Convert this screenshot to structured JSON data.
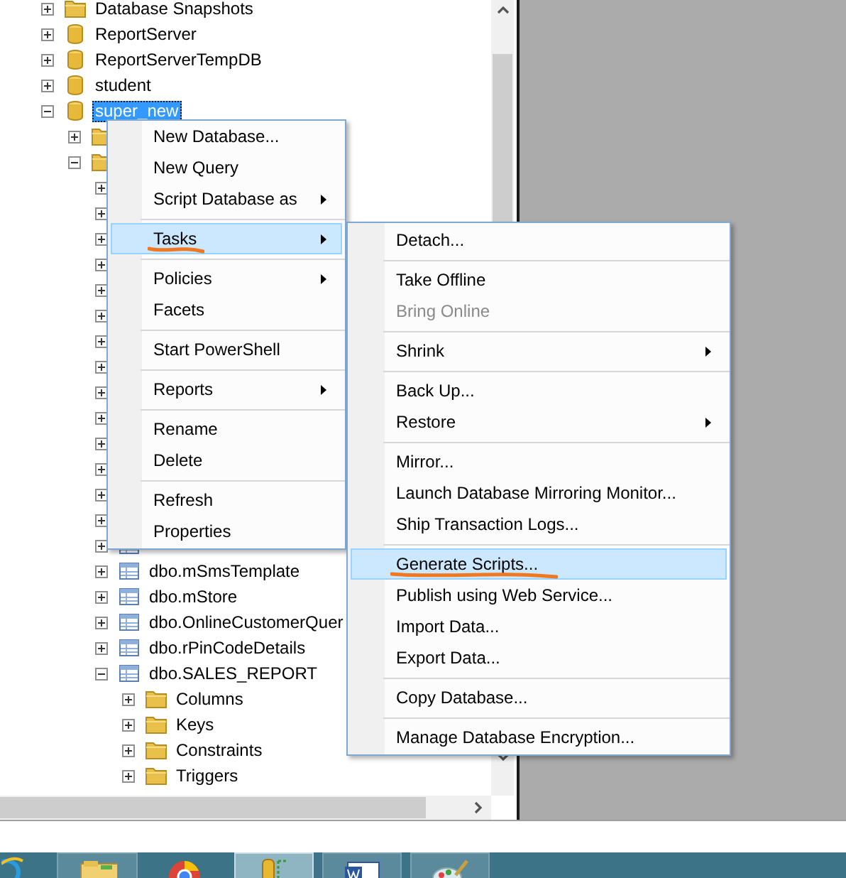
{
  "tree": [
    {
      "label": "Database Snapshots",
      "kind": "folder",
      "expanded": false
    },
    {
      "label": "ReportServer",
      "kind": "database",
      "expanded": false
    },
    {
      "label": "ReportServerTempDB",
      "kind": "database",
      "expanded": false
    },
    {
      "label": "student",
      "kind": "database",
      "expanded": false
    },
    {
      "label": "super_new",
      "kind": "database",
      "expanded": true,
      "selected": true,
      "children": [
        {
          "kind": "folder",
          "expanded": false
        },
        {
          "kind": "folder",
          "expanded": true,
          "children": [
            {
              "expanded": false
            },
            {
              "expanded": false
            },
            {
              "expanded": false
            },
            {
              "expanded": false
            },
            {
              "expanded": false
            },
            {
              "expanded": false
            },
            {
              "expanded": false
            },
            {
              "expanded": false
            },
            {
              "expanded": false
            },
            {
              "expanded": false
            },
            {
              "expanded": false
            },
            {
              "expanded": false
            },
            {
              "expanded": false
            },
            {
              "expanded": false
            },
            {
              "kind": "table",
              "expanded": false
            },
            {
              "label": "dbo.mSmsTemplate",
              "kind": "table",
              "expanded": false
            },
            {
              "label": "dbo.mStore",
              "kind": "table",
              "expanded": false
            },
            {
              "label": "dbo.OnlineCustomerQuer",
              "kind": "table",
              "expanded": false
            },
            {
              "label": "dbo.rPinCodeDetails",
              "kind": "table",
              "expanded": false
            },
            {
              "label": "dbo.SALES_REPORT",
              "kind": "table",
              "expanded": true,
              "children": [
                {
                  "label": "Columns",
                  "kind": "folder",
                  "expanded": false
                },
                {
                  "label": "Keys",
                  "kind": "folder",
                  "expanded": false
                },
                {
                  "label": "Constraints",
                  "kind": "folder",
                  "expanded": false
                },
                {
                  "label": "Triggers",
                  "kind": "folder",
                  "expanded": false
                }
              ]
            }
          ]
        }
      ]
    }
  ],
  "context_menu": [
    {
      "kind": "item",
      "label": "New Database..."
    },
    {
      "kind": "item",
      "label": "New Query"
    },
    {
      "kind": "item",
      "label": "Script Database as",
      "submenu": true
    },
    {
      "kind": "separator"
    },
    {
      "kind": "item",
      "label": "Tasks",
      "submenu": true,
      "selected": true,
      "marked": true
    },
    {
      "kind": "separator"
    },
    {
      "kind": "item",
      "label": "Policies",
      "submenu": true
    },
    {
      "kind": "item",
      "label": "Facets"
    },
    {
      "kind": "separator"
    },
    {
      "kind": "item",
      "label": "Start PowerShell"
    },
    {
      "kind": "separator"
    },
    {
      "kind": "item",
      "label": "Reports",
      "submenu": true
    },
    {
      "kind": "separator"
    },
    {
      "kind": "item",
      "label": "Rename"
    },
    {
      "kind": "item",
      "label": "Delete"
    },
    {
      "kind": "separator"
    },
    {
      "kind": "item",
      "label": "Refresh"
    },
    {
      "kind": "item",
      "label": "Properties"
    }
  ],
  "tasks_submenu": [
    {
      "kind": "item",
      "label": "Detach..."
    },
    {
      "kind": "separator"
    },
    {
      "kind": "item",
      "label": "Take Offline"
    },
    {
      "kind": "item",
      "label": "Bring Online",
      "disabled": true
    },
    {
      "kind": "separator"
    },
    {
      "kind": "item",
      "label": "Shrink",
      "submenu": true
    },
    {
      "kind": "separator"
    },
    {
      "kind": "item",
      "label": "Back Up..."
    },
    {
      "kind": "item",
      "label": "Restore",
      "submenu": true
    },
    {
      "kind": "separator"
    },
    {
      "kind": "item",
      "label": "Mirror..."
    },
    {
      "kind": "item",
      "label": "Launch Database Mirroring Monitor..."
    },
    {
      "kind": "item",
      "label": "Ship Transaction Logs..."
    },
    {
      "kind": "separator"
    },
    {
      "kind": "item",
      "label": "Generate Scripts...",
      "selected": true,
      "marked": true
    },
    {
      "kind": "item",
      "label": "Publish using Web Service..."
    },
    {
      "kind": "item",
      "label": "Import Data..."
    },
    {
      "kind": "item",
      "label": "Export Data..."
    },
    {
      "kind": "separator"
    },
    {
      "kind": "item",
      "label": "Copy Database..."
    },
    {
      "kind": "separator"
    },
    {
      "kind": "item",
      "label": "Manage Database Encryption..."
    }
  ],
  "taskbar": [
    {
      "running": false,
      "selected": false
    },
    {
      "running": true,
      "selected": false
    },
    {
      "running": false,
      "selected": false
    },
    {
      "running": true,
      "selected": true
    },
    {
      "running": true,
      "selected": false
    },
    {
      "running": true,
      "selected": false
    }
  ]
}
